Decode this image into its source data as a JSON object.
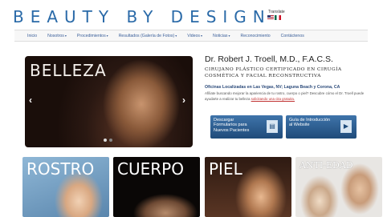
{
  "header": {
    "logo_text": "BEAUTY BY DESIGN",
    "translate_label": "Translate"
  },
  "nav": {
    "items": [
      {
        "label": "Inicio",
        "dropdown": false
      },
      {
        "label": "Nosotros",
        "dropdown": true
      },
      {
        "label": "Procedimientos",
        "dropdown": true
      },
      {
        "label": "Resultados (Galería de Fotos)",
        "dropdown": true
      },
      {
        "label": "Videos",
        "dropdown": true
      },
      {
        "label": "Noticias",
        "dropdown": true
      },
      {
        "label": "Reconocimiento",
        "dropdown": false
      },
      {
        "label": "Contáctenos",
        "dropdown": false
      }
    ],
    "caret": "▾"
  },
  "hero": {
    "title": "BELLEZA",
    "prev_glyph": "‹",
    "next_glyph": "›"
  },
  "doctor": {
    "name": "Dr. Robert J. Troell, M.D., F.A.C.S.",
    "subtitle": "CIRUJANO PLÁSTICO CERTIFICADO EN CIRUGÍA COSMÉTICA Y FACIAL RECONSTRUCTIVA",
    "offices": "Oficinas Localizadas en Las Vegas, NV; Laguna Beach y Corona, CA",
    "body": "Afíliate buscando mejorar la apariencia de tu rostro, cuerpo o piel? Descubre cómo el Dr. Troell puede ayudarte a realizar tu belleza ",
    "body_link": "solicitando una cita gratuita."
  },
  "promos": [
    {
      "text": "Descargar Formularios para Nuevos Pacientes",
      "icon": "document-icon"
    },
    {
      "text": "Guía de Introducción al Website",
      "icon": "video-icon"
    }
  ],
  "tiles": [
    {
      "label": "ROSTRO"
    },
    {
      "label": "CUERPO"
    },
    {
      "label": "PIEL"
    },
    {
      "label": "ANTI-EDAD"
    }
  ]
}
